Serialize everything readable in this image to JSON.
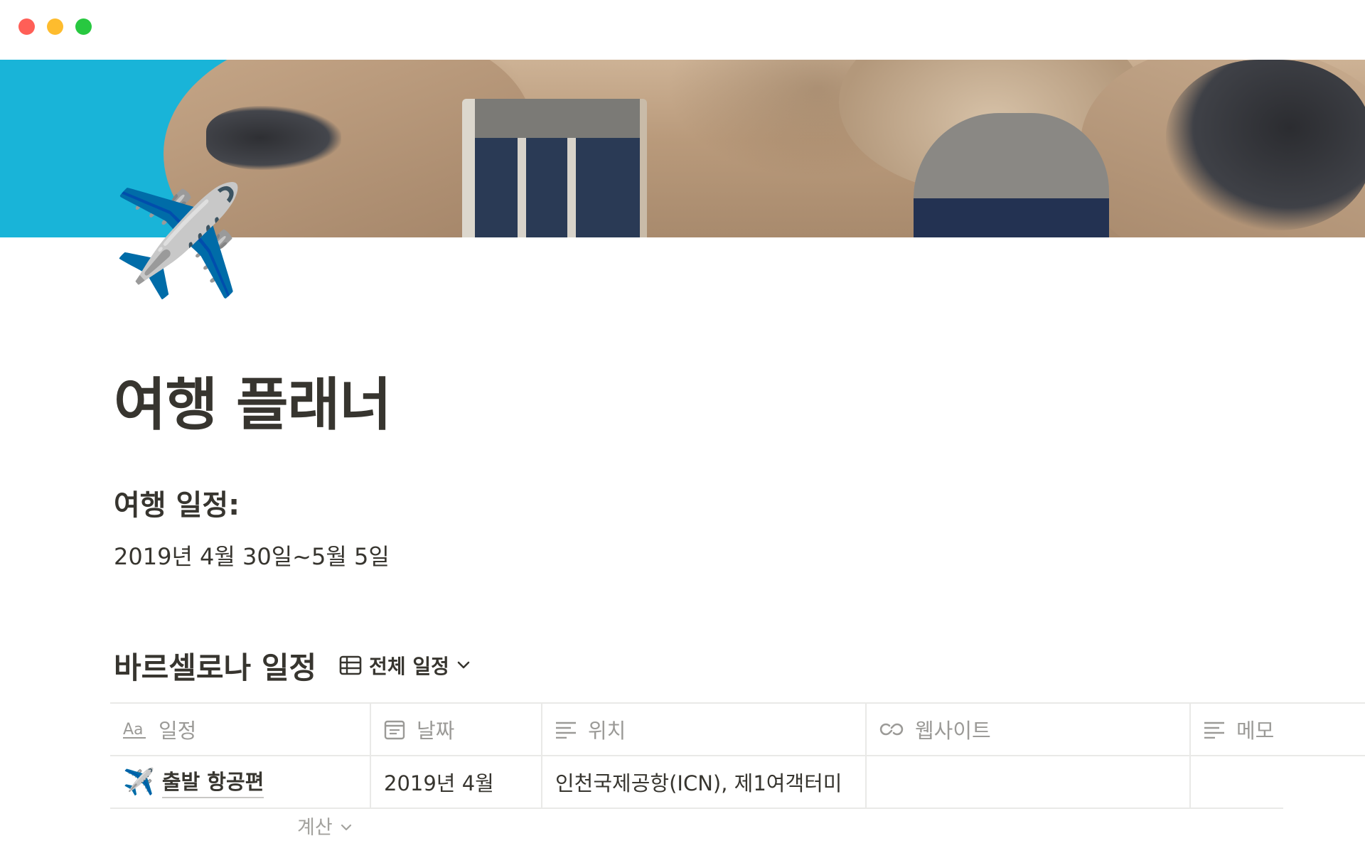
{
  "window": {
    "controls": [
      "close",
      "minimize",
      "zoom"
    ]
  },
  "page": {
    "icon": "airplane-emoji",
    "icon_glyph": "✈️",
    "title": "여행 플래너",
    "heading": "여행 일정:",
    "dates": "2019년 4월 30일~5월 5일"
  },
  "database": {
    "title": "바르셀로나 일정",
    "view_icon": "table-icon",
    "view_label": "전체 일정",
    "columns": [
      {
        "label": "일정",
        "icon": "text-title-icon"
      },
      {
        "label": "날짜",
        "icon": "calendar-icon"
      },
      {
        "label": "위치",
        "icon": "text-lines-icon"
      },
      {
        "label": "웹사이트",
        "icon": "link-icon"
      },
      {
        "label": "메모",
        "icon": "text-lines-icon"
      }
    ],
    "rows": [
      {
        "emoji": "✈️",
        "name": "출발 항공편",
        "date": "2019년 4월",
        "location": "인천국제공항(ICN), 제1여객터미",
        "website": "",
        "memo": ""
      }
    ],
    "calculate_label": "계산"
  }
}
